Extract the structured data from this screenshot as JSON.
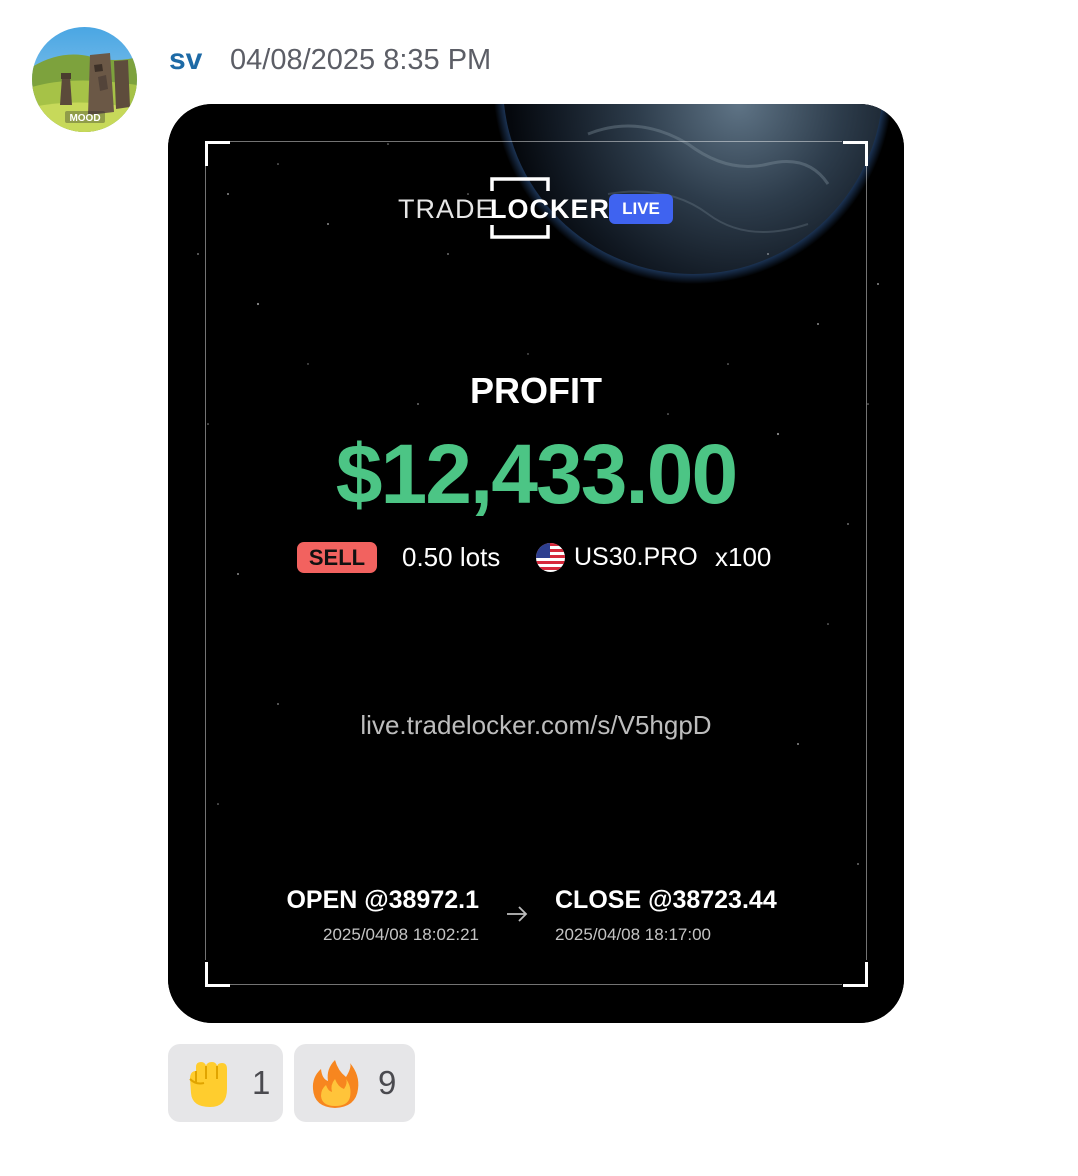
{
  "message": {
    "username": "sv",
    "timestamp": "04/08/2025 8:35 PM",
    "avatar": {
      "icon": "moai-statues-avatar",
      "badge_text": "MOOD"
    }
  },
  "card": {
    "brand": {
      "trade": "TRADE",
      "locker": "LOCKER",
      "badge": "LIVE"
    },
    "profit_label": "PROFIT",
    "profit_value": "$12,433.00",
    "profit_color": "#4cc585",
    "side": "SELL",
    "side_color": "#f2625f",
    "lots": "0.50 lots",
    "flag_icon": "us-flag-icon",
    "symbol": "US30.PRO",
    "leverage": "x100",
    "share_link": "live.tradelocker.com/s/V5hgpD",
    "open": {
      "label": "OPEN @38972.1",
      "time": "2025/04/08 18:02:21"
    },
    "close": {
      "label": "CLOSE @38723.44",
      "time": "2025/04/08 18:17:00"
    },
    "arrow_icon": "right-arrow-icon"
  },
  "reactions": [
    {
      "emoji": "raised-fist",
      "count": "1"
    },
    {
      "emoji": "fire",
      "count": "9"
    }
  ]
}
